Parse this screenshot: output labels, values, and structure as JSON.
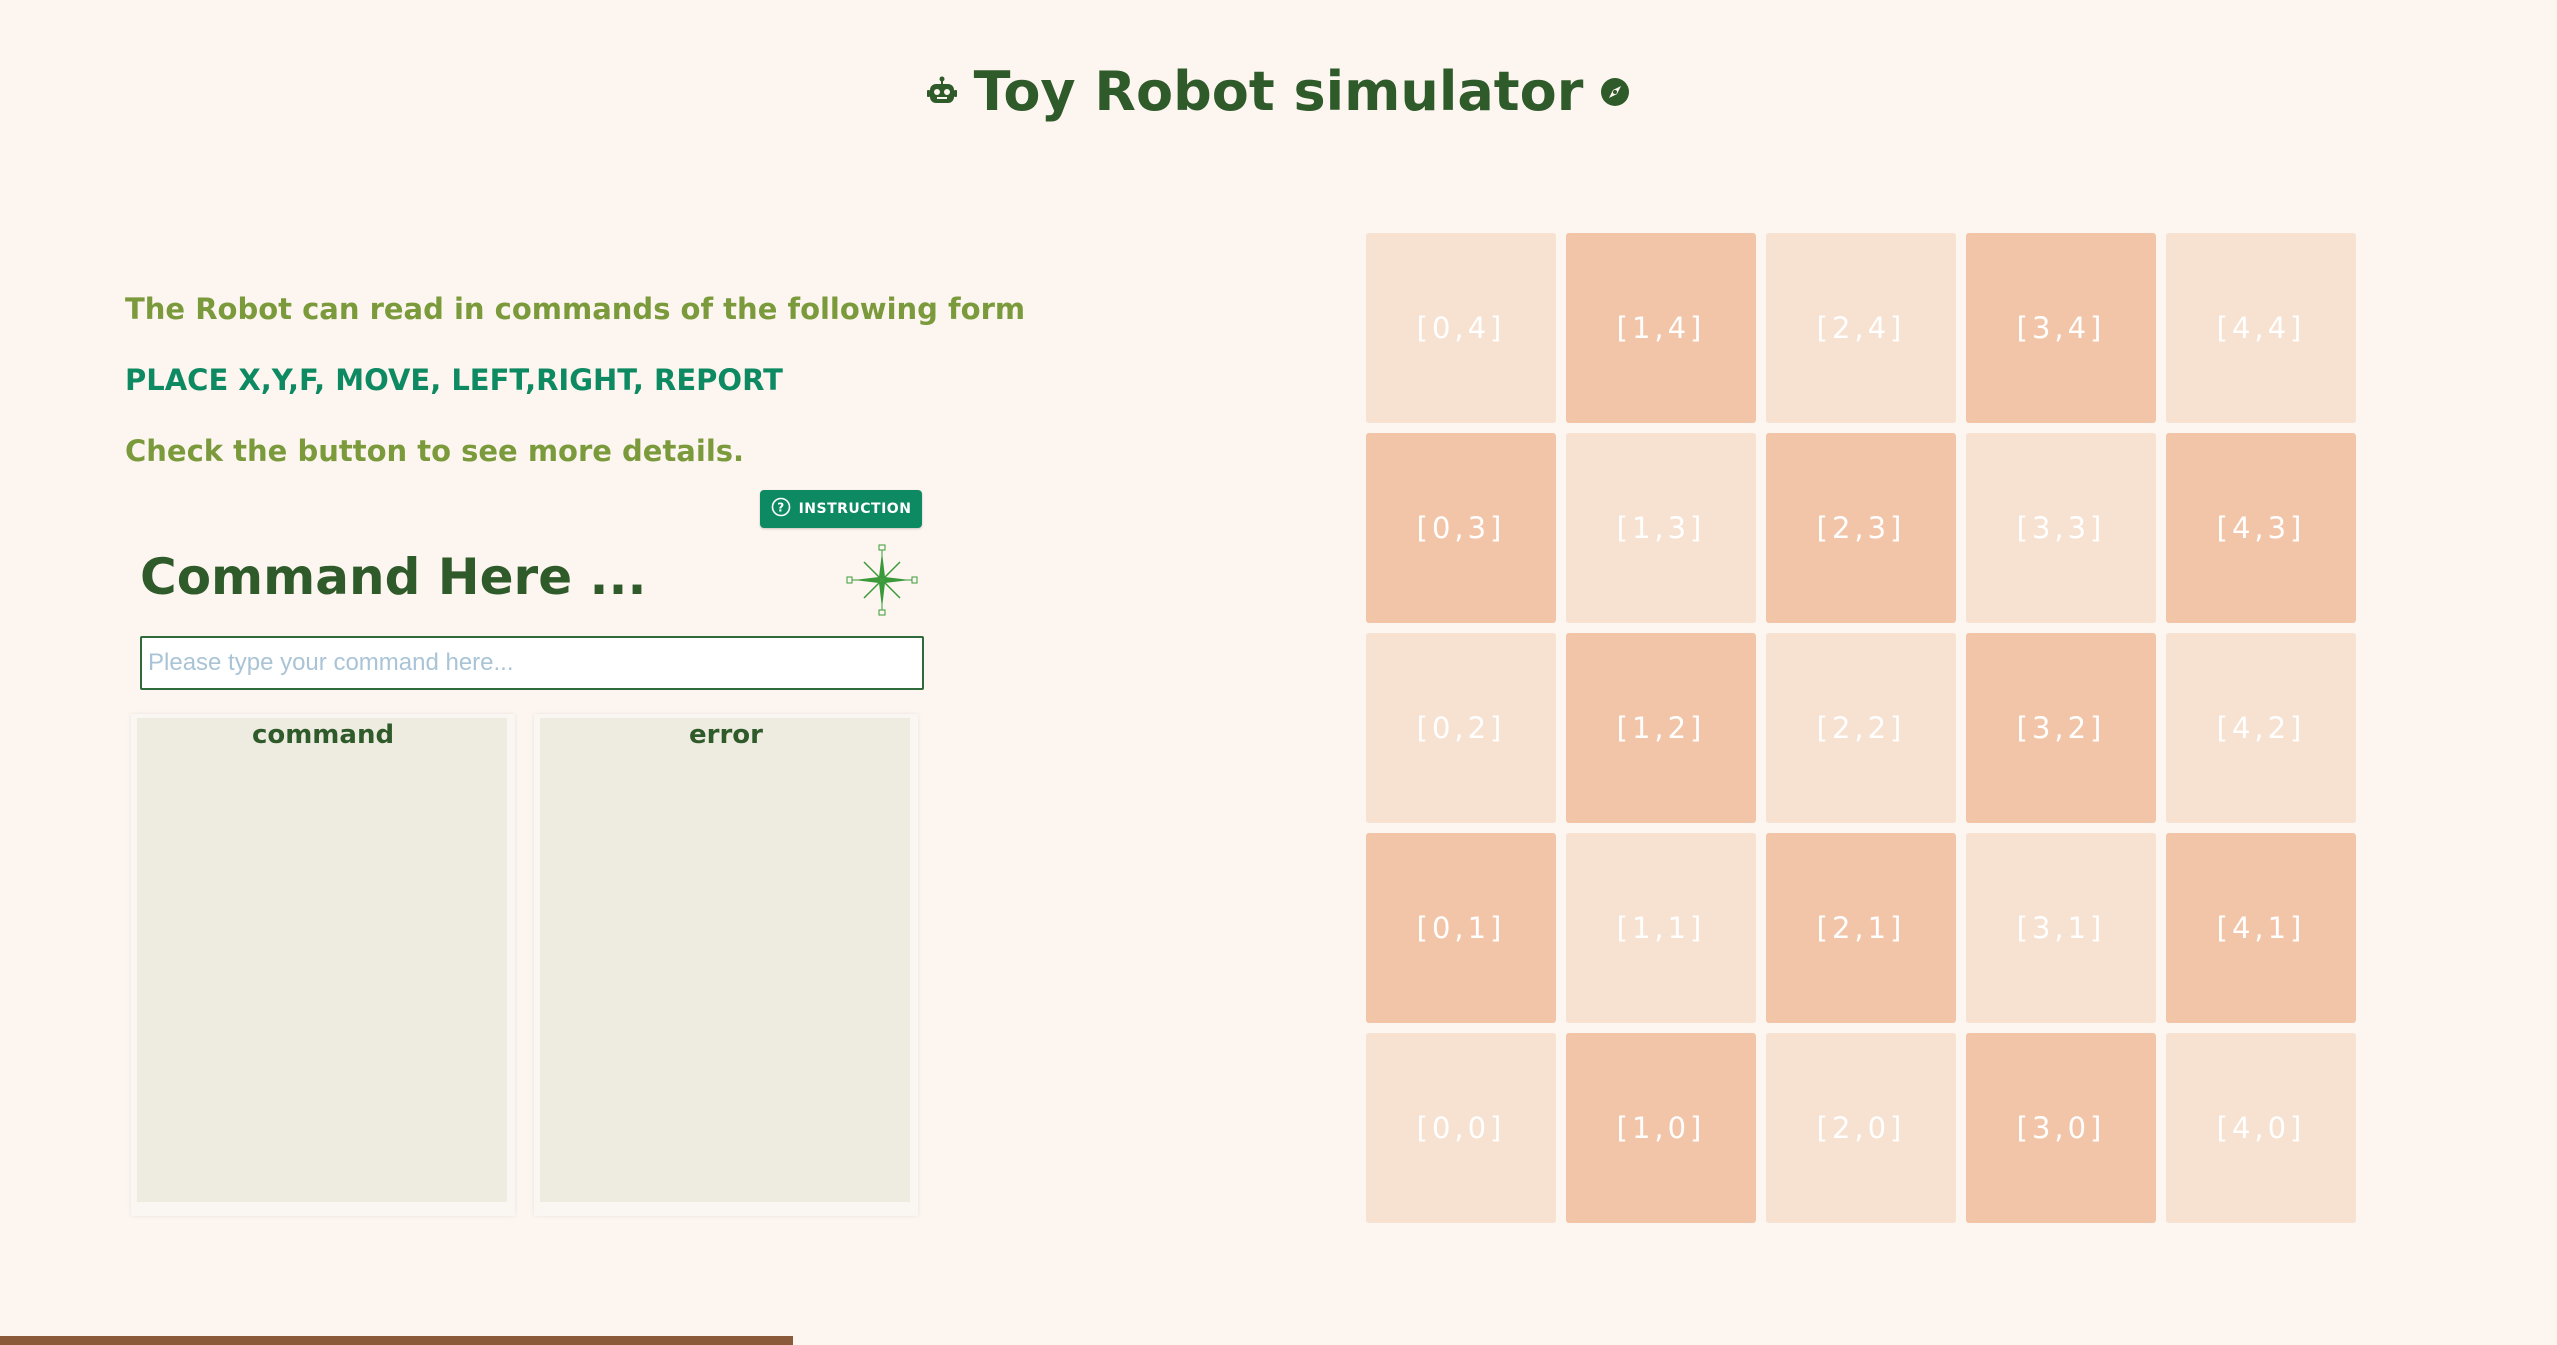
{
  "header": {
    "title": "Toy Robot simulator",
    "left_icon": "robot-icon",
    "right_icon": "compass-icon",
    "color": "#2f5a2a"
  },
  "info": {
    "line1": "The Robot can read in commands of the following form",
    "line2": "PLACE X,Y,F, MOVE, LEFT,RIGHT, REPORT",
    "line3": "Check the button to see more details."
  },
  "instruction_button": {
    "label": "INSTRUCTION",
    "icon": "help-circle-icon",
    "color": "#0e8a63"
  },
  "command": {
    "title": "Command Here ...",
    "input_placeholder": "Please type your command here...",
    "input_value": ""
  },
  "panels": {
    "command_label": "command",
    "error_label": "error"
  },
  "board": {
    "rows": [
      [
        {
          "label": "[0,4]",
          "shade": "light"
        },
        {
          "label": "[1,4]",
          "shade": "dark"
        },
        {
          "label": "[2,4]",
          "shade": "light"
        },
        {
          "label": "[3,4]",
          "shade": "dark"
        },
        {
          "label": "[4,4]",
          "shade": "light"
        }
      ],
      [
        {
          "label": "[0,3]",
          "shade": "dark"
        },
        {
          "label": "[1,3]",
          "shade": "light"
        },
        {
          "label": "[2,3]",
          "shade": "dark"
        },
        {
          "label": "[3,3]",
          "shade": "light"
        },
        {
          "label": "[4,3]",
          "shade": "dark"
        }
      ],
      [
        {
          "label": "[0,2]",
          "shade": "light"
        },
        {
          "label": "[1,2]",
          "shade": "dark"
        },
        {
          "label": "[2,2]",
          "shade": "light"
        },
        {
          "label": "[3,2]",
          "shade": "dark"
        },
        {
          "label": "[4,2]",
          "shade": "light"
        }
      ],
      [
        {
          "label": "[0,1]",
          "shade": "dark"
        },
        {
          "label": "[1,1]",
          "shade": "light"
        },
        {
          "label": "[2,1]",
          "shade": "dark"
        },
        {
          "label": "[3,1]",
          "shade": "light"
        },
        {
          "label": "[4,1]",
          "shade": "dark"
        }
      ],
      [
        {
          "label": "[0,0]",
          "shade": "light"
        },
        {
          "label": "[1,0]",
          "shade": "dark"
        },
        {
          "label": "[2,0]",
          "shade": "light"
        },
        {
          "label": "[3,0]",
          "shade": "dark"
        },
        {
          "label": "[4,0]",
          "shade": "light"
        }
      ]
    ],
    "light_color": "#f7e2d2",
    "dark_color": "#f3c5a8"
  }
}
